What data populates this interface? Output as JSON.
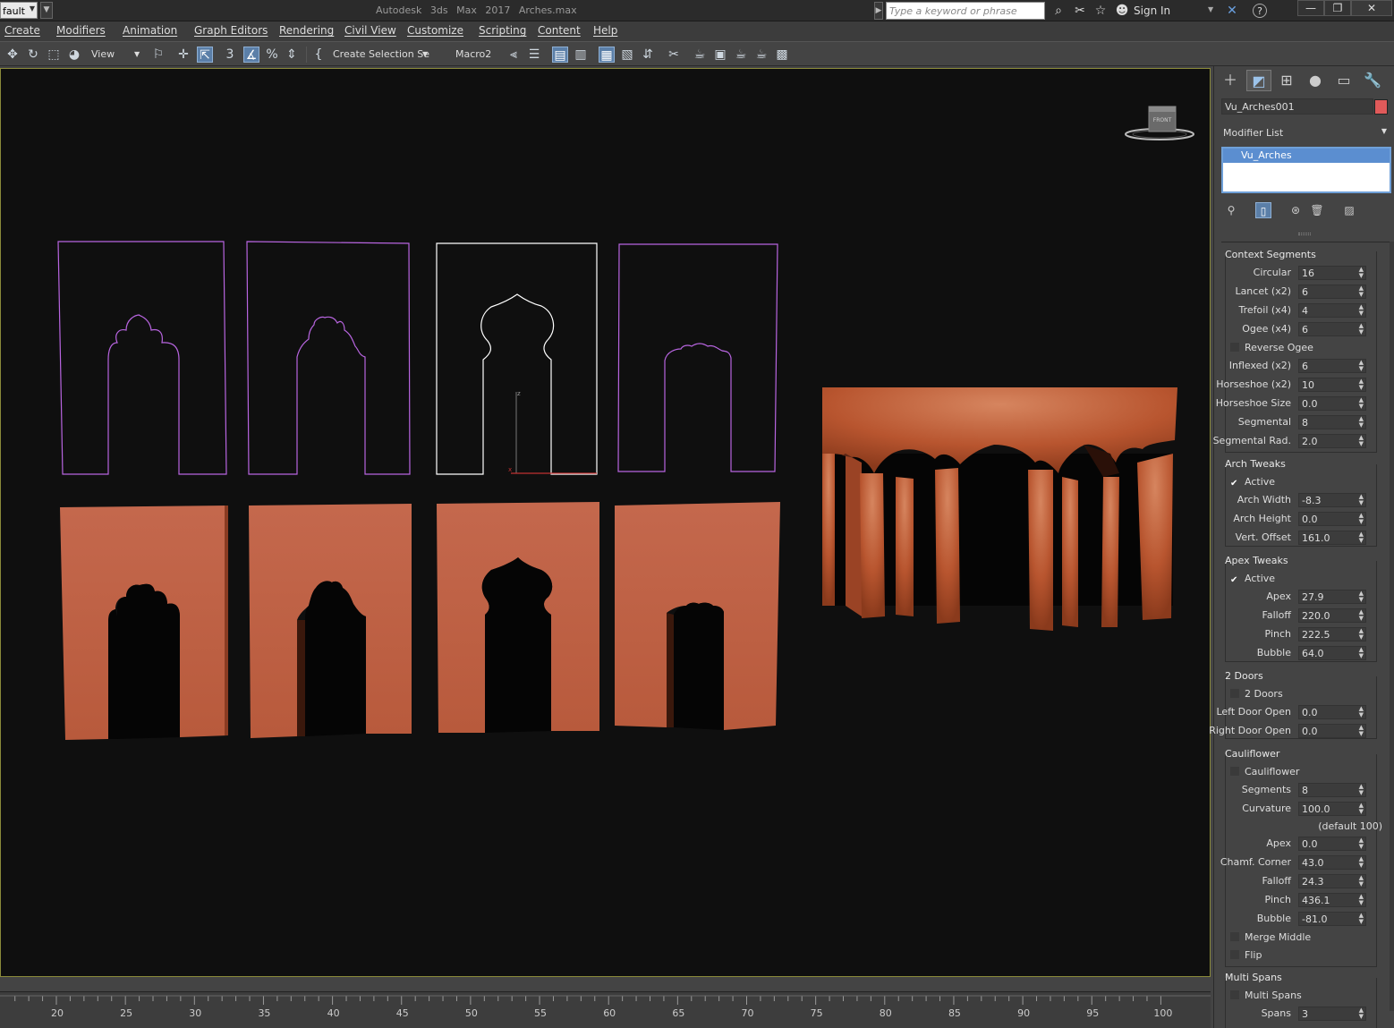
{
  "title_bar": {
    "workspace": "fault",
    "app_title": "Autodesk 3ds Max 2017",
    "file_name": "Arches.max",
    "search_placeholder": "Type a keyword or phrase",
    "sign_in": "Sign In"
  },
  "menu": [
    "Create",
    "Modifiers",
    "Animation",
    "Graph Editors",
    "Rendering",
    "Civil View",
    "Customize",
    "Scripting",
    "Content",
    "Help"
  ],
  "toolbar": {
    "ref_coord": "View",
    "selection_set": "Create Selection Se",
    "macro": "Macro2"
  },
  "viewport": {
    "viewcube_label": "FRONT",
    "colors": {
      "shape_purple": "#b865e0",
      "shape_white": "#ffffff",
      "arch_orange": "#c7664a",
      "bg": "#0f0f0f"
    }
  },
  "timeline": {
    "labels": [
      "20",
      "25",
      "30",
      "35",
      "40",
      "45",
      "50",
      "55",
      "60",
      "65",
      "70",
      "75",
      "80",
      "85",
      "90",
      "95",
      "100"
    ]
  },
  "command_panel": {
    "object_name": "Vu_Arches001",
    "object_color": "#e05a5a",
    "modifier_list_label": "Modifier List",
    "stack_item": "Vu_Arches",
    "context_segments": {
      "title": "Context Segments",
      "fields": [
        {
          "label": "Circular",
          "value": "16"
        },
        {
          "label": "Lancet (x2)",
          "value": "6"
        },
        {
          "label": "Trefoil (x4)",
          "value": "4"
        },
        {
          "label": "Ogee (x4)",
          "value": "6"
        }
      ],
      "reverse_ogee": "Reverse Ogee",
      "fields2": [
        {
          "label": "Inflexed (x2)",
          "value": "6"
        },
        {
          "label": "Horseshoe (x2)",
          "value": "10"
        },
        {
          "label": "Horseshoe Size",
          "value": "0.0"
        },
        {
          "label": "Segmental",
          "value": "8"
        },
        {
          "label": "Segmental Rad.",
          "value": "2.0"
        }
      ]
    },
    "arch_tweaks": {
      "title": "Arch Tweaks",
      "active": "Active",
      "fields": [
        {
          "label": "Arch Width",
          "value": "-8.3"
        },
        {
          "label": "Arch Height",
          "value": "0.0"
        },
        {
          "label": "Vert. Offset",
          "value": "161.0"
        }
      ]
    },
    "apex_tweaks": {
      "title": "Apex Tweaks",
      "active": "Active",
      "fields": [
        {
          "label": "Apex",
          "value": "27.9"
        },
        {
          "label": "Falloff",
          "value": "220.0"
        },
        {
          "label": "Pinch",
          "value": "222.5"
        },
        {
          "label": "Bubble",
          "value": "64.0"
        }
      ]
    },
    "two_doors": {
      "title": "2 Doors",
      "check": "2 Doors",
      "fields": [
        {
          "label": "Left Door Open",
          "value": "0.0"
        },
        {
          "label": "Right Door Open",
          "value": "0.0"
        }
      ]
    },
    "cauliflower": {
      "title": "Cauliflower",
      "check": "Cauliflower",
      "fields": [
        {
          "label": "Segments",
          "value": "8"
        },
        {
          "label": "Curvature",
          "value": "100.0"
        }
      ],
      "default_note": "(default 100)",
      "fields2": [
        {
          "label": "Apex",
          "value": "0.0"
        },
        {
          "label": "Chamf. Corner",
          "value": "43.0"
        },
        {
          "label": "Falloff",
          "value": "24.3"
        },
        {
          "label": "Pinch",
          "value": "436.1"
        },
        {
          "label": "Bubble",
          "value": "-81.0"
        }
      ],
      "merge_middle": "Merge Middle",
      "flip": "Flip"
    },
    "multi_spans": {
      "title": "Multi Spans",
      "check": "Multi Spans",
      "fields": [
        {
          "label": "Spans",
          "value": "3"
        }
      ]
    }
  }
}
